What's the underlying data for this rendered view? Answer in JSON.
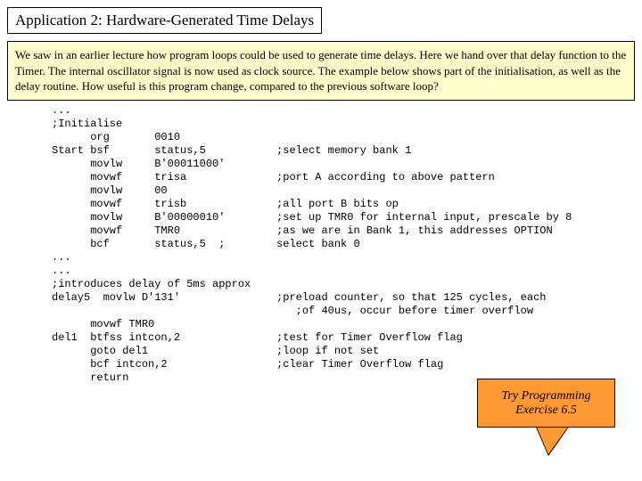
{
  "title": "Application 2: Hardware-Generated Time Delays",
  "description": "We saw in an earlier lecture how program loops could be used to generate time delays. Here we hand over that delay function to the Timer. The internal oscillator signal is now used as clock source. The example below shows part of the initialisation, as well as the delay routine. How useful is this program change, compared to the previous software loop?",
  "code": "...\n;Initialise\n      org       0010\nStart bsf       status,5           ;select memory bank 1\n      movlw     B'00011000'\n      movwf     trisa              ;port A according to above pattern\n      movlw     00\n      movwf     trisb              ;all port B bits op\n      movlw     B'00000010'        ;set up TMR0 for internal input, prescale by 8\n      movwf     TMR0               ;as we are in Bank 1, this addresses OPTION\n      bcf       status,5  ;        select bank 0\n...\n...\n;introduces delay of 5ms approx\ndelay5  movlw D'131'               ;preload counter, so that 125 cycles, each\n                                      ;of 40us, occur before timer overflow\n      movwf TMR0\ndel1  btfss intcon,2               ;test for Timer Overflow flag\n      goto del1                    ;loop if not set\n      bcf intcon,2                 ;clear Timer Overflow flag\n      return",
  "callout": "Try Programming Exercise 6.5"
}
